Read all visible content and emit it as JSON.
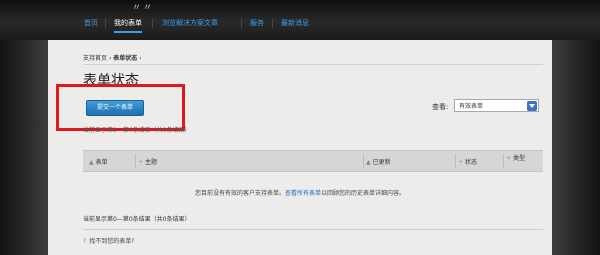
{
  "header": {
    "logo_text": "〃〃",
    "nav": [
      {
        "label": "首页"
      },
      {
        "label": "我的表单"
      },
      {
        "label": "浏览解决方案文章"
      },
      {
        "label": "服务"
      },
      {
        "label": "最新消息"
      }
    ]
  },
  "breadcrumb": {
    "home": "支持首页",
    "sep": "›",
    "current": "表单状态",
    "trail": "›"
  },
  "page": {
    "title": "表单状态",
    "submit_button": "提交一个表单",
    "view_label": "查看:",
    "view_selected": "有效表单",
    "showing_top": "当前显示第0—第0条结果（共0条结果）",
    "table_columns": [
      {
        "arrow": "▲",
        "label": "表单"
      },
      {
        "arrow": "÷",
        "label": "主题"
      },
      {
        "arrow": "▲",
        "label": "已更新"
      },
      {
        "arrow": "÷",
        "label": "状态"
      },
      {
        "arrow": "÷",
        "label": "类型"
      }
    ],
    "empty_prefix": "您目前没有有效的客户支持表单。",
    "empty_link": "查看所有表单",
    "empty_suffix": "以回顾您的历史表单详细内容。",
    "showing_bottom": "当前显示第0—第0条结果（共0条结果）",
    "help_icon": "?",
    "help_link": "找不到您的表单?"
  },
  "colors": {
    "accent": "#3aa0e8",
    "button": "#1f6fb0",
    "highlight": "#e0171d",
    "content_bg": "#eeecea"
  }
}
